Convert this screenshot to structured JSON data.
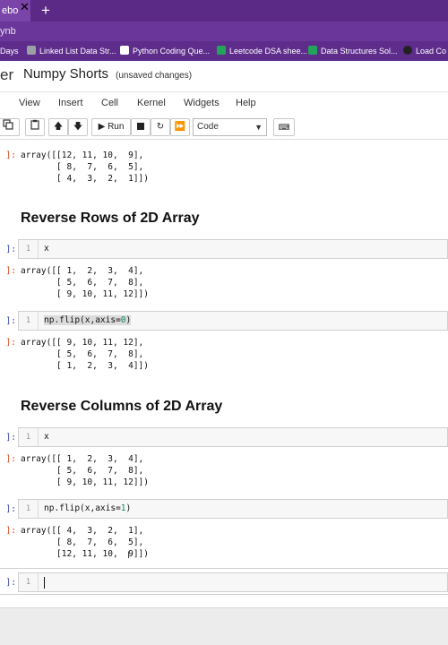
{
  "browser": {
    "tab_label": "ebo",
    "url_text": "ynb",
    "bookmarks": [
      {
        "label": "Days",
        "color": "#5e2d8c"
      },
      {
        "label": "Linked List Data Str...",
        "color": "#9aa0a6"
      },
      {
        "label": "Python Coding Que...",
        "color": "#ffffff"
      },
      {
        "label": "Leetcode DSA shee...",
        "color": "#22a55a"
      },
      {
        "label": "Data Structures Sol...",
        "color": "#22a55a"
      },
      {
        "label": "Load Co",
        "color": "#222222"
      }
    ]
  },
  "header": {
    "logo_text": "er",
    "notebook_title": "Numpy Shorts",
    "save_status": "(unsaved changes)"
  },
  "menu": [
    "View",
    "Insert",
    "Cell",
    "Kernel",
    "Widgets",
    "Help"
  ],
  "toolbar": {
    "run_label": "Run",
    "cell_type": "Code"
  },
  "cells": {
    "out1": {
      "prompt": "]:",
      "text": "array([[12, 11, 10,  9],\n       [ 8,  7,  6,  5],\n       [ 4,  3,  2,  1]])"
    },
    "heading1": "Reverse Rows of 2D Array",
    "in2": {
      "prompt": "]:",
      "line": "1",
      "code": "x"
    },
    "out2": {
      "prompt": "]:",
      "text": "array([[ 1,  2,  3,  4],\n       [ 5,  6,  7,  8],\n       [ 9, 10, 11, 12]])"
    },
    "in3": {
      "prompt": "]:",
      "line": "1",
      "code_fn": "np.flip(x,axis=",
      "code_num": "0",
      "code_end": ")"
    },
    "out3": {
      "prompt": "]:",
      "text": "array([[ 9, 10, 11, 12],\n       [ 5,  6,  7,  8],\n       [ 1,  2,  3,  4]])"
    },
    "heading2": "Reverse Columns of 2D Array",
    "in4": {
      "prompt": "]:",
      "line": "1",
      "code": "x"
    },
    "out4": {
      "prompt": "]:",
      "text": "array([[ 1,  2,  3,  4],\n       [ 5,  6,  7,  8],\n       [ 9, 10, 11, 12]])"
    },
    "in5": {
      "prompt": "]:",
      "line": "1",
      "code_fn": "np.flip(x,axis=",
      "code_num": "1",
      "code_end": ")"
    },
    "out5": {
      "prompt": "]:",
      "text": "array([[ 4,  3,  2,  1],\n       [ 8,  7,  6,  5],\n       [12, 11, 10,  9]])"
    },
    "in6": {
      "prompt": "]:",
      "line": "1"
    }
  }
}
